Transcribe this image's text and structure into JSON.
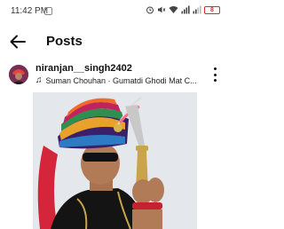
{
  "status_bar": {
    "time": "11:42 PM",
    "battery": "8"
  },
  "header": {
    "title": "Posts",
    "back_icon": "back-arrow-icon"
  },
  "post": {
    "username": "niranjan__singh2402",
    "music": "Suman Chouhan · Gumatdi Ghodi Mat C...",
    "more_icon": "more-vertical-icon",
    "image_alt": "Man in colorful striped turban holding an ornate sword"
  },
  "colors": {
    "battery_low": "#d32f2f",
    "text": "#111111"
  }
}
